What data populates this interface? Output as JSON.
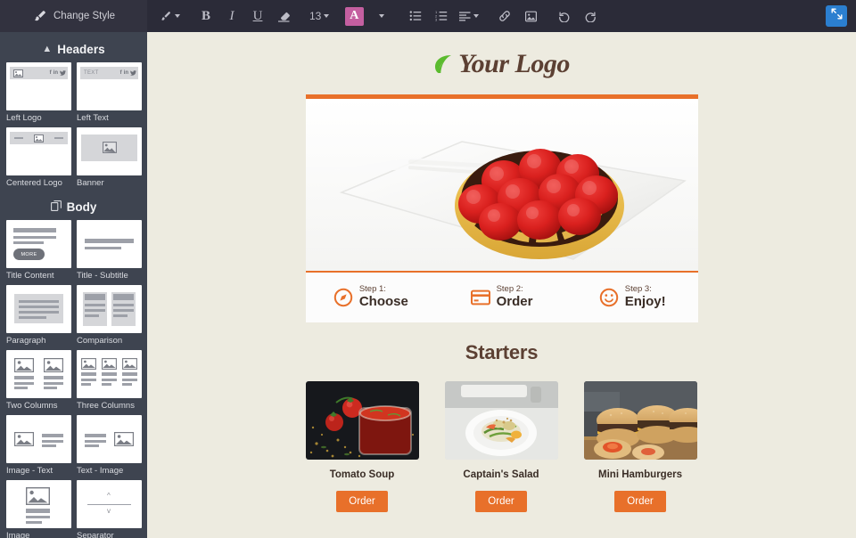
{
  "topbar": {
    "change_style_label": "Change Style",
    "brush_icon": "brush-icon",
    "tools": [
      {
        "name": "text-style-dropdown",
        "glyph": "",
        "icon": "pen-icon",
        "caret": true
      },
      {
        "name": "bold-button",
        "glyph": "B"
      },
      {
        "name": "italic-button",
        "glyph": "I"
      },
      {
        "name": "underline-button",
        "glyph": "U"
      },
      {
        "name": "clear-format-button",
        "icon": "eraser-icon"
      },
      {
        "name": "font-size-dropdown",
        "glyph": "13",
        "caret": true
      },
      {
        "name": "text-color-button",
        "glyph": "A",
        "active": true
      },
      {
        "name": "text-color-dropdown",
        "caret": true
      },
      {
        "name": "bullet-list-button",
        "icon": "bullet-list-icon"
      },
      {
        "name": "numbered-list-button",
        "icon": "numbered-list-icon"
      },
      {
        "name": "align-dropdown",
        "icon": "align-icon",
        "caret": true
      },
      {
        "name": "link-button",
        "icon": "link-icon"
      },
      {
        "name": "insert-image-button",
        "icon": "image-icon"
      },
      {
        "name": "undo-button",
        "icon": "undo-icon"
      },
      {
        "name": "redo-button",
        "icon": "redo-icon"
      }
    ],
    "font_size_value": "13",
    "expand_icon": "expand-arrows-icon",
    "accent_color": "#2B7FD0",
    "text_color_active": "#C45FA0"
  },
  "sidebar": {
    "sections": [
      {
        "title": "Headers",
        "icon": "chevron-up-icon",
        "items": [
          {
            "label": "Left Logo",
            "thumb": "left-logo"
          },
          {
            "label": "Left Text",
            "thumb": "left-text",
            "placeholder": "TEXT"
          },
          {
            "label": "Centered Logo",
            "thumb": "centered-logo"
          },
          {
            "label": "Banner",
            "thumb": "banner"
          }
        ]
      },
      {
        "title": "Body",
        "icon": "layers-icon",
        "items": [
          {
            "label": "Title Content",
            "thumb": "title-content",
            "button_label": "MORE"
          },
          {
            "label": "Title - Subtitle",
            "thumb": "title-subtitle"
          },
          {
            "label": "Paragraph",
            "thumb": "paragraph"
          },
          {
            "label": "Comparison",
            "thumb": "comparison"
          },
          {
            "label": "Two Columns",
            "thumb": "two-columns"
          },
          {
            "label": "Three Columns",
            "thumb": "three-columns"
          },
          {
            "label": "Image - Text",
            "thumb": "image-text"
          },
          {
            "label": "Text - Image",
            "thumb": "text-image"
          },
          {
            "label": "Image",
            "thumb": "image"
          },
          {
            "label": "Separator",
            "thumb": "separator"
          }
        ]
      }
    ],
    "background_color": "#3E4450"
  },
  "canvas": {
    "background_color": "#EDEBE0",
    "logo": {
      "text": "Your Logo",
      "icon": "leaf-icon",
      "icon_color": "#5BBB2E",
      "text_color": "#5C4033"
    },
    "hero": {
      "name": "raspberry-tart-photo",
      "alt": "Raspberry tart on white plate with fork"
    },
    "accent_color": "#E8702A",
    "steps": [
      {
        "number": "Step 1:",
        "title": "Choose",
        "icon": "compass-icon"
      },
      {
        "number": "Step 2:",
        "title": "Order",
        "icon": "credit-card-icon"
      },
      {
        "number": "Step 3:",
        "title": "Enjoy!",
        "icon": "smiley-icon"
      }
    ],
    "section_title": "Starters",
    "products": [
      {
        "name": "Tomato Soup",
        "button_label": "Order",
        "image": "tomato-soup-photo"
      },
      {
        "name": "Captain's Salad",
        "button_label": "Order",
        "image": "captains-salad-photo"
      },
      {
        "name": "Mini Hamburgers",
        "button_label": "Order",
        "image": "mini-hamburgers-photo"
      }
    ]
  }
}
